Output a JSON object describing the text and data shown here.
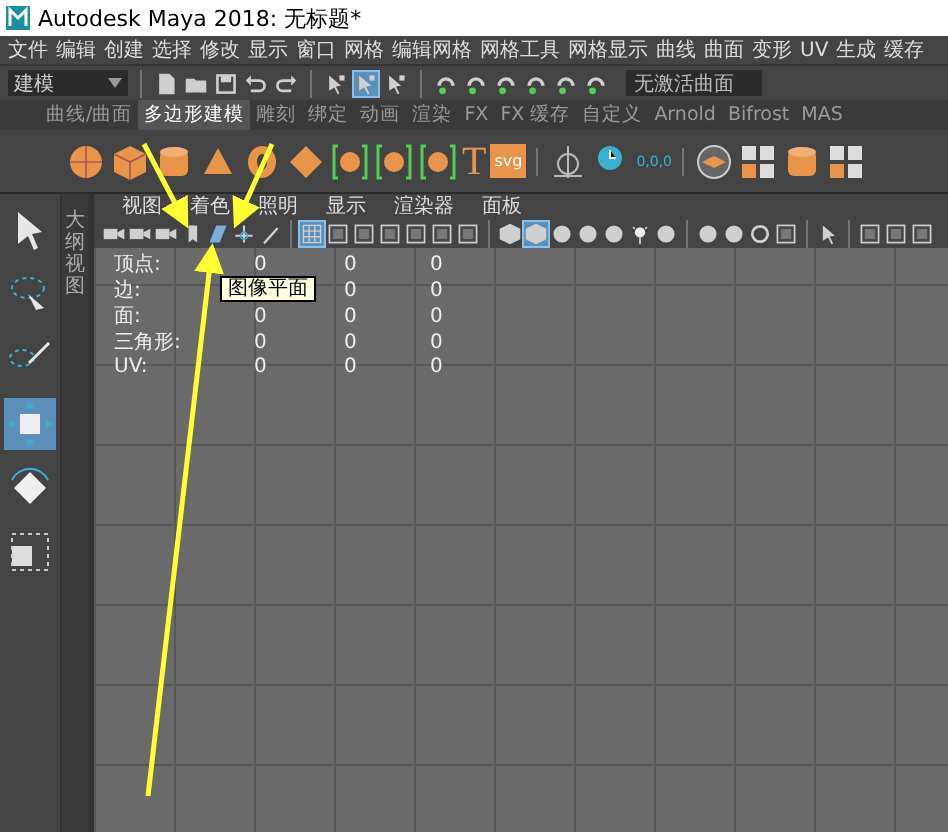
{
  "window": {
    "title": "Autodesk Maya 2018: 无标题*"
  },
  "menu_bar": [
    "文件",
    "编辑",
    "创建",
    "选择",
    "修改",
    "显示",
    "窗口",
    "网格",
    "编辑网格",
    "网格工具",
    "网格显示",
    "曲线",
    "曲面",
    "变形",
    "UV",
    "生成",
    "缓存"
  ],
  "status_line": {
    "mode": "建模",
    "tool_groups": [
      [
        {
          "kind": "file",
          "on": false
        },
        {
          "kind": "folder",
          "on": false
        },
        {
          "kind": "save",
          "on": false
        },
        {
          "kind": "undo",
          "on": false
        },
        {
          "kind": "redo",
          "on": false
        }
      ],
      [
        {
          "kind": "select",
          "on": false
        },
        {
          "kind": "select",
          "on": true
        },
        {
          "kind": "select",
          "on": false
        }
      ],
      [
        {
          "kind": "magnet",
          "on": false
        },
        {
          "kind": "magnet",
          "on": false
        },
        {
          "kind": "magnet",
          "on": false
        },
        {
          "kind": "magnet",
          "on": false
        },
        {
          "kind": "magnet",
          "on": false
        },
        {
          "kind": "magnet",
          "on": false
        }
      ]
    ],
    "live_surface": "无激活曲面"
  },
  "shelf_tabs": [
    {
      "label": "曲线/曲面",
      "selected": false
    },
    {
      "label": "多边形建模",
      "selected": true
    },
    {
      "label": "雕刻",
      "selected": false
    },
    {
      "label": "绑定",
      "selected": false
    },
    {
      "label": "动画",
      "selected": false
    },
    {
      "label": "渲染",
      "selected": false
    },
    {
      "label": "FX",
      "selected": false
    },
    {
      "label": "FX 缓存",
      "selected": false
    },
    {
      "label": "自定义",
      "selected": false
    },
    {
      "label": "Arnold",
      "selected": false
    },
    {
      "label": "Bifrost",
      "selected": false
    },
    {
      "label": "MAS",
      "selected": false
    }
  ],
  "shelf": [
    {
      "kind": "sphere"
    },
    {
      "kind": "cube"
    },
    {
      "kind": "cylinder"
    },
    {
      "kind": "cone"
    },
    {
      "kind": "torus"
    },
    {
      "kind": "diamond"
    },
    {
      "kind": "bracket"
    },
    {
      "kind": "bracket"
    },
    {
      "kind": "bracket"
    },
    {
      "kind": "text",
      "label": "T"
    },
    {
      "kind": "badge",
      "label": "svg"
    },
    {
      "kind": "sep"
    },
    {
      "kind": "locator"
    },
    {
      "kind": "clock"
    },
    {
      "kind": "coords",
      "label": "0,0,0"
    },
    {
      "kind": "sep"
    },
    {
      "kind": "layers"
    },
    {
      "kind": "blocks"
    },
    {
      "kind": "cylinder"
    },
    {
      "kind": "blocks"
    }
  ],
  "toolbox": [
    {
      "kind": "arrow",
      "selected": false
    },
    {
      "kind": "lasso",
      "selected": false
    },
    {
      "kind": "brush",
      "selected": false
    },
    {
      "kind": "move",
      "selected": true
    },
    {
      "kind": "rotate",
      "selected": false
    },
    {
      "kind": "scale",
      "selected": false
    }
  ],
  "outliner_tab": "大纲视图",
  "panel_menu": [
    "视图",
    "着色",
    "照明",
    "显示",
    "渲染器",
    "面板"
  ],
  "panel_toolbar": [
    [
      {
        "kind": "camera",
        "on": false
      },
      {
        "kind": "camera",
        "on": false
      },
      {
        "kind": "camera",
        "on": false
      },
      {
        "kind": "flag",
        "on": false
      },
      {
        "kind": "plane",
        "on": false
      },
      {
        "kind": "axes",
        "on": false
      },
      {
        "kind": "pencil",
        "on": false
      }
    ],
    [
      {
        "kind": "grid",
        "on": true
      },
      {
        "kind": "frame",
        "on": false
      },
      {
        "kind": "frame",
        "on": false
      },
      {
        "kind": "frame",
        "on": false
      },
      {
        "kind": "frame",
        "on": false
      },
      {
        "kind": "frame",
        "on": false
      },
      {
        "kind": "frame",
        "on": false
      }
    ],
    [
      {
        "kind": "cube",
        "on": false
      },
      {
        "kind": "cube",
        "on": true
      },
      {
        "kind": "sphere",
        "on": false
      },
      {
        "kind": "sphere",
        "on": false
      },
      {
        "kind": "sphere",
        "on": false
      },
      {
        "kind": "light",
        "on": false
      },
      {
        "kind": "sphere",
        "on": false
      }
    ],
    [
      {
        "kind": "sphere",
        "on": false
      },
      {
        "kind": "sphere",
        "on": false
      },
      {
        "kind": "ring",
        "on": false
      },
      {
        "kind": "frame",
        "on": false
      }
    ],
    [
      {
        "kind": "cursor",
        "on": false
      }
    ],
    [
      {
        "kind": "frame",
        "on": false
      },
      {
        "kind": "frame",
        "on": false
      },
      {
        "kind": "frame",
        "on": false
      }
    ]
  ],
  "hud_stats": [
    {
      "label": "顶点:",
      "col_1": "0",
      "col_2": "0",
      "col_3": "0"
    },
    {
      "label": "边:",
      "col_2": "0",
      "col_3": "0"
    },
    {
      "label": "面:",
      "col_1": "0",
      "col_2": "0",
      "col_3": "0"
    },
    {
      "label": "三角形:",
      "col_1": "0",
      "col_2": "0",
      "col_3": "0"
    },
    {
      "label": "UV:",
      "col_1": "0",
      "col_2": "0",
      "col_3": "0"
    }
  ],
  "tooltip": "图像平面"
}
